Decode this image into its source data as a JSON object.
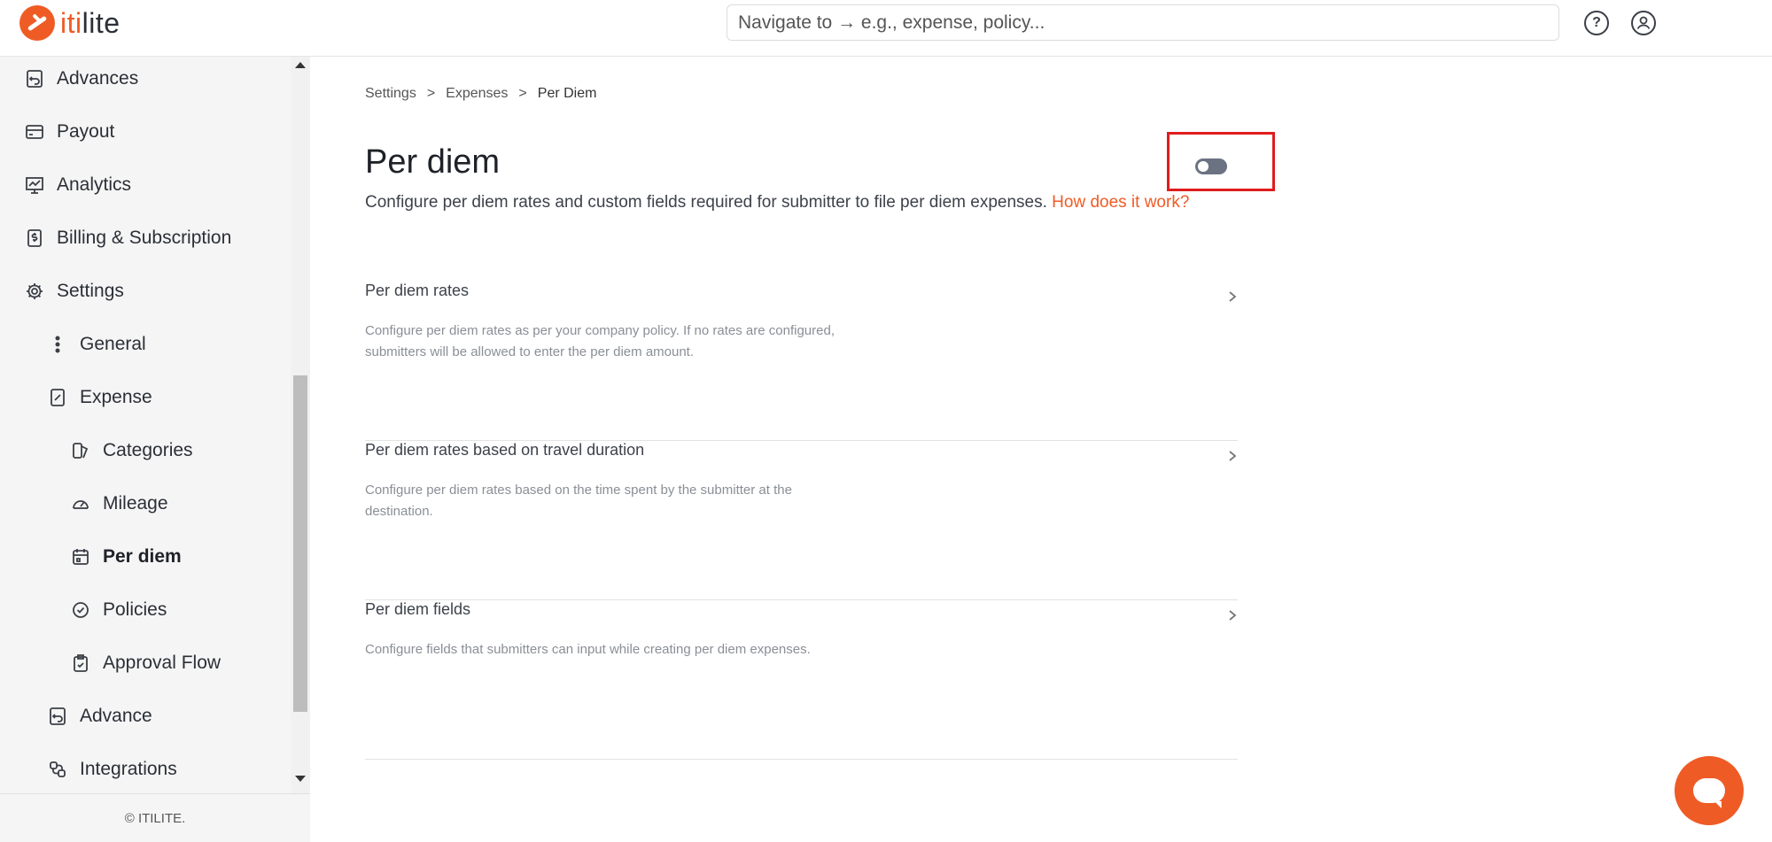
{
  "brand": {
    "prefix": "iti",
    "suffix": "lite"
  },
  "search": {
    "placeholder": "Navigate to → e.g., expense, policy..."
  },
  "header": {
    "help_icon": "question-circle-icon",
    "user_icon": "user-circle-icon"
  },
  "sidebar": {
    "items": [
      {
        "label": "Advances",
        "icon": "advances-icon"
      },
      {
        "label": "Payout",
        "icon": "payout-icon"
      },
      {
        "label": "Analytics",
        "icon": "analytics-icon"
      },
      {
        "label": "Billing & Subscription",
        "icon": "billing-icon"
      },
      {
        "label": "Settings",
        "icon": "gear-icon"
      },
      {
        "label": "General",
        "icon": "dots-vertical-icon"
      },
      {
        "label": "Expense",
        "icon": "expense-icon"
      },
      {
        "label": "Categories",
        "icon": "categories-icon"
      },
      {
        "label": "Mileage",
        "icon": "mileage-icon"
      },
      {
        "label": "Per diem",
        "icon": "calendar-icon"
      },
      {
        "label": "Policies",
        "icon": "policies-icon"
      },
      {
        "label": "Approval Flow",
        "icon": "approval-icon"
      },
      {
        "label": "Advance",
        "icon": "advance-icon"
      },
      {
        "label": "Integrations",
        "icon": "integrations-icon"
      }
    ],
    "active_item": "Per diem",
    "footer": "© ITILITE."
  },
  "main": {
    "breadcrumb": [
      "Settings",
      ">",
      "Expenses",
      ">",
      "Per Diem"
    ],
    "title": "Per diem",
    "toggle_state": "off",
    "description": "Configure per diem rates and custom fields required for submitter to file per diem expenses.",
    "description_link": "How does it work?",
    "sections": [
      {
        "title": "Per diem rates",
        "description": "Configure per diem rates as per your company policy. If no rates are configured, submitters will be allowed to enter the per diem amount."
      },
      {
        "title": "Per diem rates based on travel duration",
        "description": "Configure per diem rates based on the time spent by the submitter at the destination."
      },
      {
        "title": "Per diem fields",
        "description": "Configure fields that submitters can input while creating per diem expenses."
      }
    ]
  },
  "colors": {
    "accent": "#ef5b25",
    "highlight_border": "#e01c1c",
    "toggle_off": "#6b7282"
  }
}
